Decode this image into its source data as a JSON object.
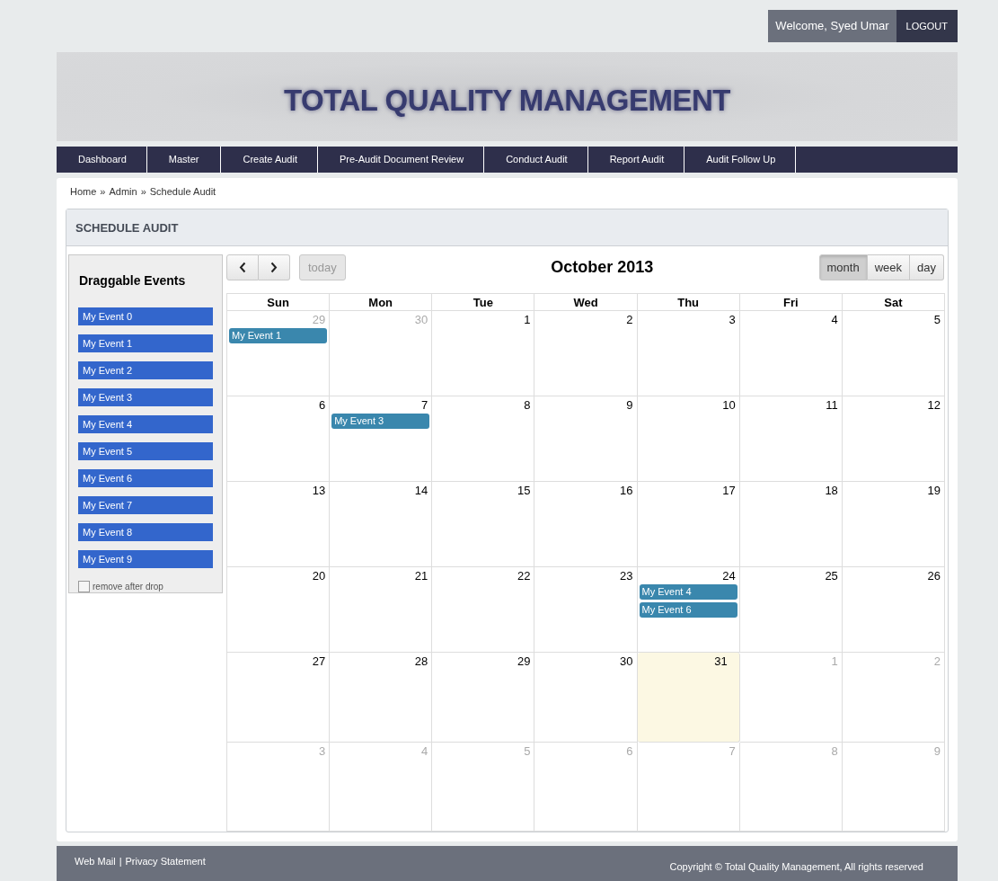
{
  "user_bar": {
    "welcome": "Welcome, Syed Umar",
    "logout": "LOGOUT"
  },
  "banner": {
    "title": "TOTAL QUALITY MANAGEMENT"
  },
  "nav": {
    "items": [
      {
        "label": "Dashboard"
      },
      {
        "label": "Master"
      },
      {
        "label": "Create Audit"
      },
      {
        "label": "Pre-Audit Document Review"
      },
      {
        "label": "Conduct Audit"
      },
      {
        "label": "Report Audit"
      },
      {
        "label": "Audit Follow Up"
      }
    ]
  },
  "breadcrumb": {
    "separator": "»",
    "items": [
      {
        "label": "Home"
      },
      {
        "label": "Admin"
      },
      {
        "label": "Schedule Audit"
      }
    ]
  },
  "panel": {
    "title": "SCHEDULE AUDIT"
  },
  "draggable": {
    "title": "Draggable Events",
    "events": [
      "My Event 0",
      "My Event 1",
      "My Event 2",
      "My Event 3",
      "My Event 4",
      "My Event 5",
      "My Event 6",
      "My Event 7",
      "My Event 8",
      "My Event 9"
    ],
    "remove_after_drop": {
      "label": "remove after drop",
      "checked": false
    }
  },
  "calendar": {
    "today_button": {
      "label": "today",
      "disabled": true
    },
    "title": "October 2013",
    "views": [
      {
        "label": "month",
        "selected": true
      },
      {
        "label": "week",
        "selected": false
      },
      {
        "label": "day",
        "selected": false
      }
    ],
    "day_names": [
      "Sun",
      "Mon",
      "Tue",
      "Wed",
      "Thu",
      "Fri",
      "Sat"
    ],
    "weeks": [
      [
        {
          "day": "29",
          "other_month": true,
          "today": false,
          "events": [
            "My Event 1"
          ]
        },
        {
          "day": "30",
          "other_month": true,
          "today": false
        },
        {
          "day": "1",
          "other_month": false,
          "today": false
        },
        {
          "day": "2",
          "other_month": false,
          "today": false
        },
        {
          "day": "3",
          "other_month": false,
          "today": false
        },
        {
          "day": "4",
          "other_month": false,
          "today": false
        },
        {
          "day": "5",
          "other_month": false,
          "today": false
        }
      ],
      [
        {
          "day": "6",
          "other_month": false,
          "today": false
        },
        {
          "day": "7",
          "other_month": false,
          "today": false,
          "events": [
            "My Event 3"
          ]
        },
        {
          "day": "8",
          "other_month": false,
          "today": false
        },
        {
          "day": "9",
          "other_month": false,
          "today": false
        },
        {
          "day": "10",
          "other_month": false,
          "today": false
        },
        {
          "day": "11",
          "other_month": false,
          "today": false
        },
        {
          "day": "12",
          "other_month": false,
          "today": false
        }
      ],
      [
        {
          "day": "13",
          "other_month": false,
          "today": false
        },
        {
          "day": "14",
          "other_month": false,
          "today": false
        },
        {
          "day": "15",
          "other_month": false,
          "today": false
        },
        {
          "day": "16",
          "other_month": false,
          "today": false
        },
        {
          "day": "17",
          "other_month": false,
          "today": false
        },
        {
          "day": "18",
          "other_month": false,
          "today": false
        },
        {
          "day": "19",
          "other_month": false,
          "today": false
        }
      ],
      [
        {
          "day": "20",
          "other_month": false,
          "today": false
        },
        {
          "day": "21",
          "other_month": false,
          "today": false
        },
        {
          "day": "22",
          "other_month": false,
          "today": false
        },
        {
          "day": "23",
          "other_month": false,
          "today": false
        },
        {
          "day": "24",
          "other_month": false,
          "today": false,
          "events": [
            "My Event 4",
            "My Event 6"
          ]
        },
        {
          "day": "25",
          "other_month": false,
          "today": false
        },
        {
          "day": "26",
          "other_month": false,
          "today": false
        }
      ],
      [
        {
          "day": "27",
          "other_month": false,
          "today": false
        },
        {
          "day": "28",
          "other_month": false,
          "today": false
        },
        {
          "day": "29",
          "other_month": false,
          "today": false
        },
        {
          "day": "30",
          "other_month": false,
          "today": false
        },
        {
          "day": "31",
          "other_month": false,
          "today": true
        },
        {
          "day": "1",
          "other_month": true,
          "today": false
        },
        {
          "day": "2",
          "other_month": true,
          "today": false
        }
      ],
      [
        {
          "day": "3",
          "other_month": true,
          "today": false
        },
        {
          "day": "4",
          "other_month": true,
          "today": false
        },
        {
          "day": "5",
          "other_month": true,
          "today": false
        },
        {
          "day": "6",
          "other_month": true,
          "today": false
        },
        {
          "day": "7",
          "other_month": true,
          "today": false
        },
        {
          "day": "8",
          "other_month": true,
          "today": false
        },
        {
          "day": "9",
          "other_month": true,
          "today": false
        }
      ]
    ]
  },
  "footer": {
    "links": [
      "Web Mail",
      "Privacy Statement"
    ],
    "separator": "|",
    "copyright": "Copyright © Total Quality Management, All rights reserved"
  }
}
